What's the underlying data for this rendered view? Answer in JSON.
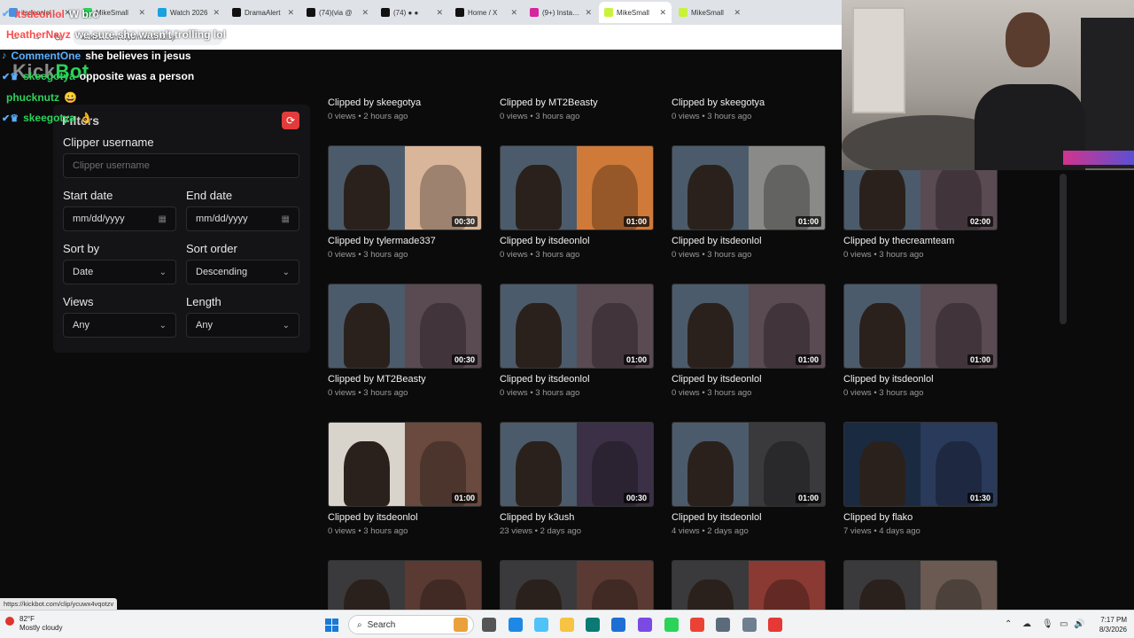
{
  "browser": {
    "tabs": [
      {
        "title": "itsdeonlol - Transfer",
        "fav": "#4a90e2",
        "active": false
      },
      {
        "title": "MikeSmall",
        "fav": "#2bd35a",
        "active": false
      },
      {
        "title": "Watch 2026",
        "fav": "#1aa1e0",
        "active": false
      },
      {
        "title": "DramaAlert",
        "fav": "#111111",
        "active": false
      },
      {
        "title": "(74)(via @",
        "fav": "#111111",
        "active": false
      },
      {
        "title": "(74) ● ●",
        "fav": "#111111",
        "active": false
      },
      {
        "title": "Home / X",
        "fav": "#111111",
        "active": false
      },
      {
        "title": "(9+) Instagram",
        "fav": "#d6249f",
        "active": false
      },
      {
        "title": "MikeSmall",
        "fav": "#c9f23a",
        "active": true
      },
      {
        "title": "MikeSmall",
        "fav": "#c9f23a",
        "active": false
      }
    ],
    "url": "kickbot.com/clips/mikesmallsjr",
    "status_url": "https://kickbot.com/clip/ycuwx4vqotzv"
  },
  "site": {
    "logo_prefix": "Kick",
    "logo_suffix": "Bot"
  },
  "chat": [
    {
      "user": "itsdeonlol",
      "user_color": "#ff4b4b",
      "message": "W bro",
      "badge": "✔"
    },
    {
      "user": "HeatherNayz",
      "user_color": "#ff4b4b",
      "message": "we sure she wasn't trolling lol",
      "badge": ""
    },
    {
      "user": "CommentOne",
      "user_color": "#5ab0ff",
      "message": "she believes in jesus",
      "badge": "♪"
    },
    {
      "user": "skeegotya",
      "user_color": "#2bd35a",
      "message": "opposite was a person",
      "badge": "✔♛"
    },
    {
      "user": "phucknutz",
      "user_color": "#2bd35a",
      "message": "😀",
      "badge": ""
    },
    {
      "user": "skeegotya",
      "user_color": "#2bd35a",
      "message": "👌",
      "badge": "✔♛"
    }
  ],
  "filters": {
    "title": "Filters",
    "clipper_label": "Clipper username",
    "clipper_placeholder": "Clipper username",
    "start_label": "Start date",
    "start_value": "mm/dd/yyyy",
    "end_label": "End date",
    "end_value": "mm/dd/yyyy",
    "sortby_label": "Sort by",
    "sortby_value": "Date",
    "sortorder_label": "Sort order",
    "sortorder_value": "Descending",
    "views_label": "Views",
    "views_value": "Any",
    "length_label": "Length",
    "length_value": "Any"
  },
  "top_partial": [
    {
      "by": "Clipped by skeegotya",
      "meta": "0 views • 2 hours ago"
    },
    {
      "by": "Clipped by MT2Beasty",
      "meta": "0 views • 3 hours ago"
    },
    {
      "by": "Clipped by skeegotya",
      "meta": "0 views • 3 hours ago"
    }
  ],
  "clips": [
    {
      "by": "Clipped by tylermade337",
      "meta": "0 views • 3 hours ago",
      "duration": "00:30",
      "left": "#4b5b6b",
      "right": "#d9b59a"
    },
    {
      "by": "Clipped by itsdeonlol",
      "meta": "0 views • 3 hours ago",
      "duration": "01:00",
      "left": "#4b5b6b",
      "right": "#d07a3a"
    },
    {
      "by": "Clipped by itsdeonlol",
      "meta": "0 views • 3 hours ago",
      "duration": "01:00",
      "left": "#4b5b6b",
      "right": "#8a8a88"
    },
    {
      "by": "Clipped by thecreamteam",
      "meta": "0 views • 3 hours ago",
      "duration": "02:00",
      "left": "#4b5b6b",
      "right": "#5a4a52"
    },
    {
      "by": "Clipped by MT2Beasty",
      "meta": "0 views • 3 hours ago",
      "duration": "00:30",
      "left": "#4b5b6b",
      "right": "#5a4a52"
    },
    {
      "by": "Clipped by itsdeonlol",
      "meta": "0 views • 3 hours ago",
      "duration": "01:00",
      "left": "#4b5b6b",
      "right": "#5a4a52"
    },
    {
      "by": "Clipped by itsdeonlol",
      "meta": "0 views • 3 hours ago",
      "duration": "01:00",
      "left": "#4b5b6b",
      "right": "#5a4a52"
    },
    {
      "by": "Clipped by itsdeonlol",
      "meta": "0 views • 3 hours ago",
      "duration": "01:00",
      "left": "#4b5b6b",
      "right": "#5a4a52"
    },
    {
      "by": "Clipped by itsdeonlol",
      "meta": "0 views • 3 hours ago",
      "duration": "01:00",
      "left": "#d8d4cc",
      "right": "#6a4a3e"
    },
    {
      "by": "Clipped by k3ush",
      "meta": "23 views • 2 days ago",
      "duration": "00:30",
      "left": "#4b5b6b",
      "right": "#3c3046"
    },
    {
      "by": "Clipped by itsdeonlol",
      "meta": "4 views • 2 days ago",
      "duration": "01:00",
      "left": "#4b5b6b",
      "right": "#3a3a3c"
    },
    {
      "by": "Clipped by flako",
      "meta": "7 views • 4 days ago",
      "duration": "01:30",
      "left": "#1a2a40",
      "right": "#2a3a5a"
    },
    {
      "by": "",
      "meta": "",
      "duration": "",
      "left": "#3a3a3c",
      "right": "#5a3a32"
    },
    {
      "by": "",
      "meta": "",
      "duration": "",
      "left": "#3a3a3c",
      "right": "#5a3a32"
    },
    {
      "by": "",
      "meta": "",
      "duration": "",
      "left": "#3a3a3c",
      "right": "#8a3a32"
    },
    {
      "by": "",
      "meta": "",
      "duration": "",
      "left": "#3a3a3c",
      "right": "#6a5a52"
    }
  ],
  "taskbar": {
    "temp": "82°F",
    "weather": "Mostly cloudy",
    "search": "Search",
    "time": "7:17 PM",
    "date": "8/3/2026",
    "apps": [
      "#e9a23b",
      "#555555",
      "#1e88e5",
      "#4fc3f7",
      "#f6c343",
      "#0b7a75",
      "#1f6ed4",
      "#7b4ae2",
      "#2bd35a",
      "#ea4335",
      "#5b6b7b",
      "#6f7f8f",
      "#e53935"
    ]
  }
}
